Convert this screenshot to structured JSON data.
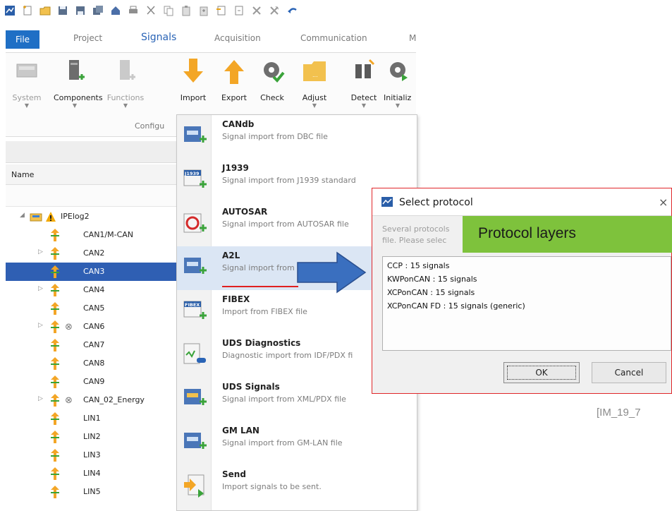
{
  "quick_access": {
    "icons": [
      "app-icon",
      "new-doc-icon",
      "open-folder-icon",
      "save-icon",
      "save-as-icon",
      "save-all-icon",
      "database-icon",
      "print-icon",
      "cut-icon",
      "copy-icon",
      "paste-icon",
      "paste-special-icon",
      "insert-icon",
      "duplicate-icon",
      "delete-icon",
      "delete-all-icon",
      "undo-icon"
    ]
  },
  "menu": {
    "file": "File",
    "project": "Project",
    "signals": "Signals",
    "acquisition": "Acquisition",
    "communication": "Communication",
    "more": "M"
  },
  "ribbon": {
    "group_label": "Configu",
    "buttons": [
      {
        "label": "System",
        "disabled": true
      },
      {
        "label": "Components",
        "disabled": false
      },
      {
        "label": "Functions",
        "disabled": true
      },
      {
        "label": "Import",
        "disabled": false
      },
      {
        "label": "Export",
        "disabled": false
      },
      {
        "label": "Check",
        "disabled": false
      },
      {
        "label": "Adjust",
        "disabled": false
      },
      {
        "label": "Detect",
        "disabled": false
      },
      {
        "label": "Initializ",
        "disabled": false
      }
    ]
  },
  "left_panel": {
    "column_header": "Name",
    "tree": [
      {
        "label": "IPElog2",
        "type": "root"
      },
      {
        "label": "CAN1/M-CAN"
      },
      {
        "label": "CAN2",
        "expander": true
      },
      {
        "label": "CAN3",
        "selected": true
      },
      {
        "label": "CAN4",
        "expander": true
      },
      {
        "label": "CAN5"
      },
      {
        "label": "CAN6",
        "expander": true,
        "blocked": true
      },
      {
        "label": "CAN7"
      },
      {
        "label": "CAN8"
      },
      {
        "label": "CAN9"
      },
      {
        "label": "CAN_02_Energy",
        "expander": true,
        "blocked": true
      },
      {
        "label": "LIN1"
      },
      {
        "label": "LIN2"
      },
      {
        "label": "LIN3"
      },
      {
        "label": "LIN4"
      },
      {
        "label": "LIN5"
      }
    ]
  },
  "import_menu": {
    "items": [
      {
        "title": "CANdb",
        "desc": "Signal import from DBC file"
      },
      {
        "title": "J1939",
        "desc": "Signal import from J1939 standard"
      },
      {
        "title": "AUTOSAR",
        "desc": "Signal import from AUTOSAR file"
      },
      {
        "title": "A2L",
        "desc": "Signal import from"
      },
      {
        "title": "FIBEX",
        "desc": "Import from FIBEX file"
      },
      {
        "title": "UDS Diagnostics",
        "desc": "Diagnostic import from IDF/PDX fi"
      },
      {
        "title": "UDS Signals",
        "desc": "Signal import from XML/PDX file"
      },
      {
        "title": "GM LAN",
        "desc": "Signal import from GM-LAN file"
      },
      {
        "title": "Send",
        "desc": "Import signals to be sent."
      }
    ],
    "j1939_badge": "J1939",
    "fibex_badge": "FIBEX"
  },
  "dialog": {
    "title": "Select protocol",
    "close": "×",
    "message_line1": "Several protocols",
    "message_line2": "file. Please selec",
    "protocols": [
      "CCP : 15 signals",
      "KWPonCAN : 15 signals",
      "XCPonCAN : 15 signals",
      "XCPonCAN FD : 15 signals  (generic)"
    ],
    "ok": "OK",
    "cancel": "Cancel"
  },
  "annotation": {
    "text": "Protocol layers"
  },
  "reference": "[IM_19_7"
}
